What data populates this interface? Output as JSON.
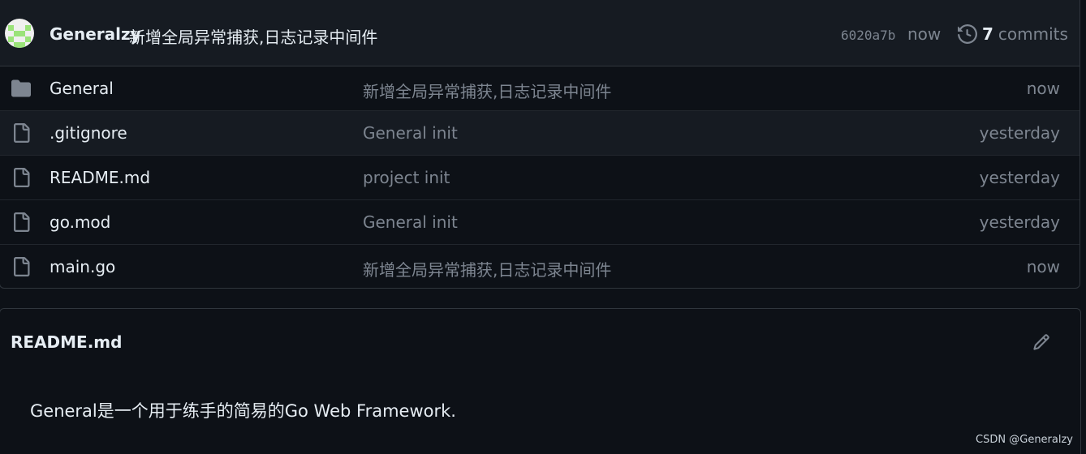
{
  "latest_commit": {
    "author": "Generalzy",
    "message": "新增全局异常捕获,日志记录中间件",
    "sha": "6020a7b",
    "time": "now",
    "commit_count": "7",
    "commits_label": "commits"
  },
  "files": [
    {
      "name": "General",
      "type": "folder-icon",
      "commit_message": "新增全局异常捕获,日志记录中间件",
      "age": "now"
    },
    {
      "name": ".gitignore",
      "type": "file-icon",
      "commit_message": "General init",
      "age": "yesterday"
    },
    {
      "name": "README.md",
      "type": "file-icon",
      "commit_message": "project init",
      "age": "yesterday"
    },
    {
      "name": "go.mod",
      "type": "file-icon",
      "commit_message": "General init",
      "age": "yesterday"
    },
    {
      "name": "main.go",
      "type": "file-icon",
      "commit_message": "新增全局异常捕获,日志记录中间件",
      "age": "now"
    }
  ],
  "readme": {
    "title": "README.md",
    "body": "General是一个用于练手的简易的Go Web Framework."
  },
  "watermark": "CSDN @Generalzy",
  "colors": {
    "background": "#0d1117",
    "header_bg": "#161b22",
    "border": "#30363d",
    "text_primary": "#e6edf3",
    "text_muted": "#7d8590",
    "avatar_accent": "#9be37a"
  }
}
